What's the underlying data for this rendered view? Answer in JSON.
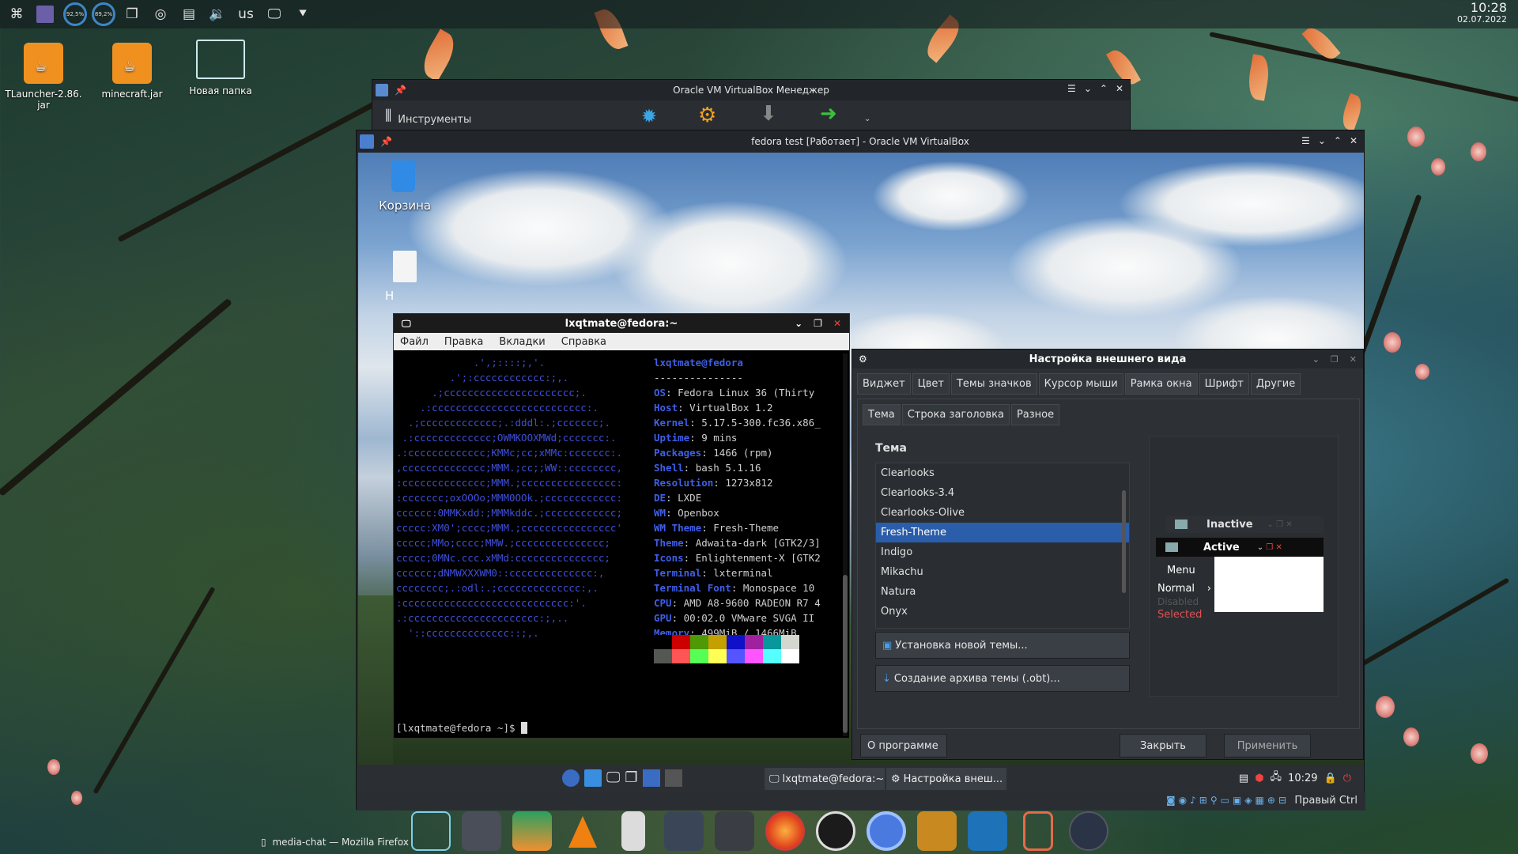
{
  "top_panel": {
    "gauges": [
      "92,5%",
      "89,2%"
    ],
    "keyboard_layout": "us",
    "clock_time": "10:28",
    "clock_date": "02.07.2022"
  },
  "desktop_icons": [
    {
      "label": "TLauncher-2.86.\njar"
    },
    {
      "label": "minecraft.jar"
    },
    {
      "label": "Новая папка"
    }
  ],
  "vbox_manager": {
    "title": "Oracle VM VirtualBox Менеджер",
    "tools_label": "Инструменты"
  },
  "vm_window": {
    "title": "fedora test [Работает] - Oracle VM VirtualBox",
    "trash_label": "Корзина",
    "file_label": "H"
  },
  "terminal": {
    "title": "lxqtmate@fedora:~",
    "menu": [
      "Файл",
      "Правка",
      "Вкладки",
      "Справка"
    ],
    "logo_lines": [
      "             .',;::::;,'.",
      "         .';:cccccccccccc:;,.",
      "      .;cccccccccccccccccccccc;.",
      "    .:cccccccccccccccccccccccccc:.",
      "  .;ccccccccccccc;.:dddl:.;ccccccc;.",
      " .:ccccccccccccc;OWMKOOXMWd;ccccccc:.",
      ".:ccccccccccccc;KMMc;cc;xMMc:ccccccc:.",
      ",cccccccccccccc;MMM.;cc;;WW::cccccccc,",
      ":cccccccccccccc;MMM.;cccccccccccccccc:",
      ":ccccccc;oxOOOo;MMM0OOk.;cccccccccccc:",
      "cccccc:0MMKxdd:;MMMkddc.;cccccccccccc;",
      "ccccc:XM0';cccc;MMM.;cccccccccccccccc'",
      "ccccc;MMo;cccc;MMW.;ccccccccccccccc;",
      "ccccc;0MNc.ccc.xMMd:ccccccccccccccc;",
      "cccccc;dNMWXXXWM0::cccccccccccccc:,",
      "cccccccc;.:odl:.;cccccccccccccc:,.",
      ":cccccccccccccccccccccccccccc:'.",
      ".:cccccccccccccccccccccc:;,..",
      "  '::cccccccccccccc::;,."
    ],
    "user_host": "lxqtmate@fedora",
    "separator": "---------------",
    "info": [
      {
        "k": "OS",
        "v": "Fedora Linux 36 (Thirty"
      },
      {
        "k": "Host",
        "v": "VirtualBox 1.2"
      },
      {
        "k": "Kernel",
        "v": "5.17.5-300.fc36.x86_"
      },
      {
        "k": "Uptime",
        "v": "9 mins"
      },
      {
        "k": "Packages",
        "v": "1466 (rpm)"
      },
      {
        "k": "Shell",
        "v": "bash 5.1.16"
      },
      {
        "k": "Resolution",
        "v": "1273x812"
      },
      {
        "k": "DE",
        "v": "LXDE"
      },
      {
        "k": "WM",
        "v": "Openbox"
      },
      {
        "k": "WM Theme",
        "v": "Fresh-Theme"
      },
      {
        "k": "Theme",
        "v": "Adwaita-dark [GTK2/3]"
      },
      {
        "k": "Icons",
        "v": "Enlightenment-X [GTK2"
      },
      {
        "k": "Terminal",
        "v": "lxterminal"
      },
      {
        "k": "Terminal Font",
        "v": "Monospace 10"
      },
      {
        "k": "CPU",
        "v": "AMD A8-9600 RADEON R7 4"
      },
      {
        "k": "GPU",
        "v": "00:02.0 VMware SVGA II"
      },
      {
        "k": "Memory",
        "v": "499MiB / 1466MiB"
      }
    ],
    "swatches_top": [
      "#000000",
      "#cc0000",
      "#4e9a06",
      "#c4a000",
      "#1010c8",
      "#a020a0",
      "#06989a",
      "#d3d7cf"
    ],
    "swatches_bottom": [
      "#555753",
      "#ff5555",
      "#55ff55",
      "#ffff55",
      "#5555ff",
      "#ff55ff",
      "#55ffff",
      "#ffffff"
    ],
    "prompt": "[lxqtmate@fedora ~]$ "
  },
  "appearance": {
    "title": "Настройка внешнего вида",
    "tabs": [
      "Виджет",
      "Цвет",
      "Темы значков",
      "Курсор мыши",
      "Рамка окна",
      "Шрифт",
      "Другие"
    ],
    "subtabs": [
      "Тема",
      "Строка заголовка",
      "Разное"
    ],
    "theme_heading": "Тема",
    "themes": [
      "Clearlooks",
      "Clearlooks-3.4",
      "Clearlooks-Olive",
      "Fresh-Theme",
      "Indigo",
      "Mikachu",
      "Natura",
      "Onyx"
    ],
    "selected_theme": "Fresh-Theme",
    "install_btn": "Установка новой темы...",
    "archive_btn": "Создание архива темы (.obt)...",
    "about_btn": "О программе",
    "close_btn": "Закрыть",
    "apply_btn": "Применить",
    "preview": {
      "inactive": "Inactive",
      "active": "Active",
      "menu": "Menu",
      "normal": "Normal",
      "disabled": "Disabled",
      "selected": "Selected"
    }
  },
  "vm_panel": {
    "task1": "lxqtmate@fedora:~",
    "task2": "Настройка внеш...",
    "time": "10:29"
  },
  "vm_status": {
    "host_key": "Правый Ctrl"
  },
  "firefox_task": "media-chat — Mozilla Firefox",
  "colors": {
    "accent": "#2a5daa",
    "terminal_key": "#3f5fe8",
    "logo_blue": "#3f4fdb",
    "jar_orange": "#f0901f"
  }
}
